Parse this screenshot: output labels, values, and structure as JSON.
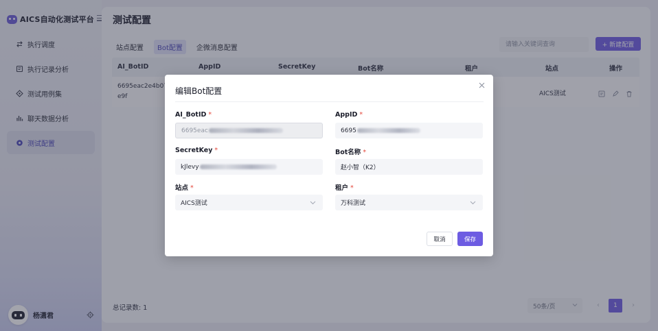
{
  "app": {
    "title": "AICS自动化测试平台"
  },
  "sidebar": {
    "items": [
      {
        "label": "执行调度",
        "icon": "swap-arrows-icon",
        "active": false
      },
      {
        "label": "执行记录分析",
        "icon": "record-list-icon",
        "active": false
      },
      {
        "label": "测试用例集",
        "icon": "puzzle-icon",
        "active": false
      },
      {
        "label": "聊天数据分析",
        "icon": "bar-chart-icon",
        "active": false
      },
      {
        "label": "测试配置",
        "icon": "config-gear-icon",
        "active": true
      }
    ],
    "user": {
      "name": "杨潇君"
    }
  },
  "main": {
    "title": "测试配置",
    "tabs": [
      {
        "label": "站点配置",
        "active": false
      },
      {
        "label": "Bot配置",
        "active": true
      },
      {
        "label": "企微消息配置",
        "active": false
      }
    ],
    "search": {
      "placeholder": "请输入关键词查询"
    },
    "new_button": {
      "label": "+ 新建配置"
    },
    "table": {
      "columns": [
        "AI_BotID",
        "AppID",
        "SecretKey",
        "Bot名称",
        "租户",
        "站点",
        "操作"
      ],
      "rows": [
        {
          "bot_id_line1": "6695eac2e4b07f4",
          "bot_id_line2": "e9f",
          "site": "AICS测试"
        }
      ]
    },
    "footer": {
      "total_label": "总记录数:",
      "total_value": "1",
      "page_size": "50条/页",
      "current_page": "1"
    }
  },
  "dialog": {
    "title": "编辑Bot配置",
    "fields": {
      "bot_id": {
        "label": "AI_BotID",
        "value": "6695eac"
      },
      "app_id": {
        "label": "AppID",
        "value": "6695"
      },
      "secret_key": {
        "label": "SecretKey",
        "value": "kJlevy"
      },
      "bot_name": {
        "label": "Bot名称",
        "value": "赵小智（K2）"
      },
      "site": {
        "label": "站点",
        "value": "AICS测试"
      },
      "tenant": {
        "label": "租户",
        "value": "万科测试"
      }
    },
    "required_mark": "*",
    "cancel_label": "取消",
    "save_label": "保存"
  },
  "colors": {
    "accent": "#6d5ce2",
    "active_text": "#4c47b8",
    "required": "#e4473b"
  }
}
